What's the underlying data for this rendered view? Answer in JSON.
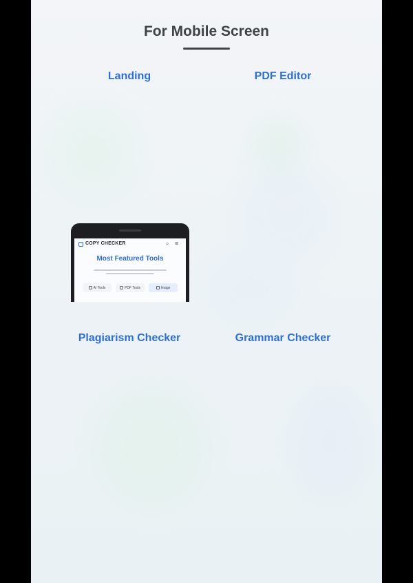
{
  "page": {
    "title": "For Mobile Screen"
  },
  "previews": [
    {
      "label": "Landing"
    },
    {
      "label": "PDF Editor"
    },
    {
      "label": "Plagiarism Checker"
    },
    {
      "label": "Grammar Checker"
    }
  ],
  "device_preview": {
    "brand": "COPY CHECKER",
    "hero_title": "Most Featured Tools",
    "chips": [
      "AI Tools",
      "PDF Tools",
      "Image"
    ],
    "icons": {
      "search": "search-icon",
      "menu": "menu-icon",
      "logo": "logo-icon"
    }
  },
  "colors": {
    "accent": "#2f6fd0",
    "title": "#3f4348",
    "background": "#f2f5f7"
  }
}
